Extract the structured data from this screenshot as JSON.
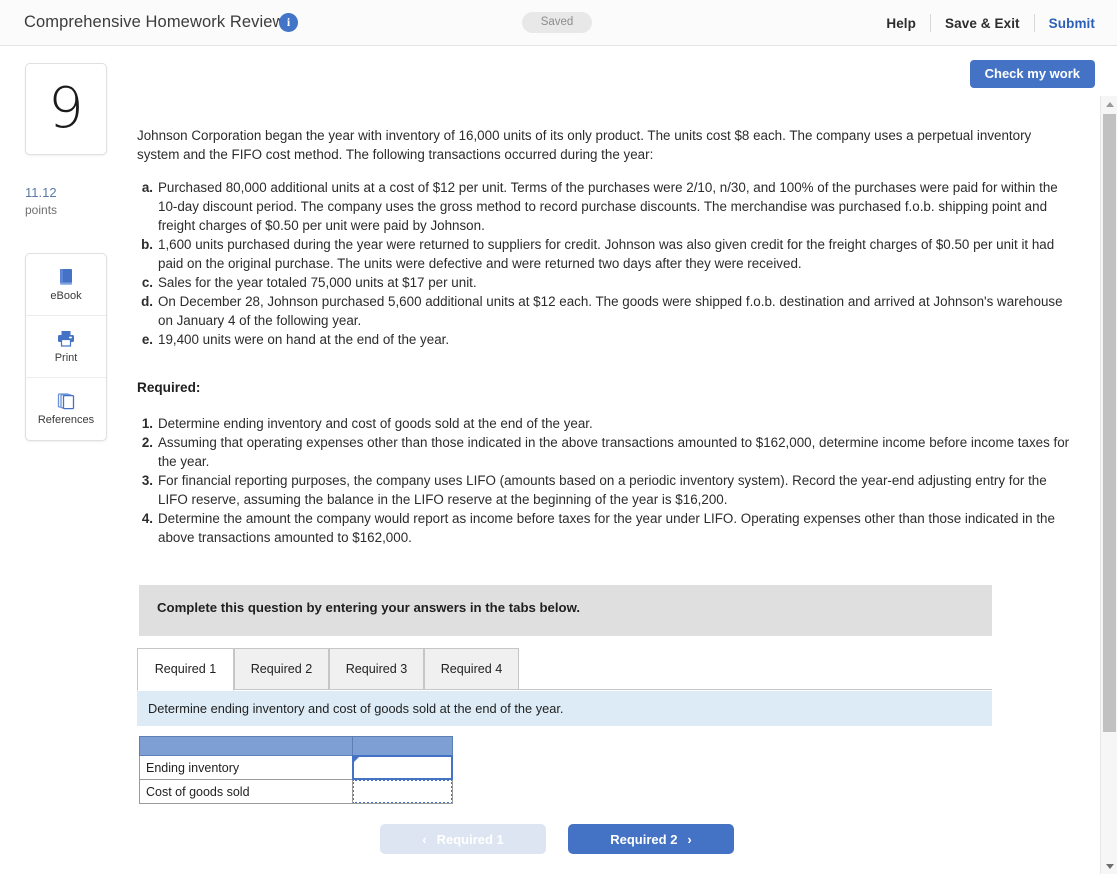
{
  "header": {
    "title": "Comprehensive Homework Review",
    "info_icon": "info-icon",
    "saved_label": "Saved",
    "help_label": "Help",
    "save_exit_label": "Save & Exit",
    "submit_label": "Submit",
    "accent_color": "#4472c4",
    "link_color": "#2c5fb8"
  },
  "sidebar": {
    "question_number": "9",
    "points_value": "11.12",
    "points_label": "points",
    "tools": [
      {
        "label": "eBook",
        "icon": "book-icon"
      },
      {
        "label": "Print",
        "icon": "printer-icon"
      },
      {
        "label": "References",
        "icon": "copy-pages-icon"
      }
    ]
  },
  "toolbar": {
    "check_my_work_label": "Check my work"
  },
  "question": {
    "intro": "Johnson Corporation began the year with inventory of 16,000 units of its only product. The units cost $8 each. The company uses a perpetual inventory system and the FIFO cost method. The following transactions occurred during the year:",
    "transactions": [
      {
        "marker": "a.",
        "text": "Purchased 80,000 additional units at a cost of $12 per unit. Terms of the purchases were 2/10, n/30, and 100% of the purchases were paid for within the 10-day discount period. The company uses the gross method to record purchase discounts. The merchandise was purchased f.o.b. shipping point and freight charges of $0.50 per unit were paid by Johnson."
      },
      {
        "marker": "b.",
        "text": "1,600 units purchased during the year were returned to suppliers for credit. Johnson was also given credit for the freight charges of $0.50 per unit it had paid on the original purchase. The units were defective and were returned two days after they were received."
      },
      {
        "marker": "c.",
        "text": "Sales for the year totaled 75,000 units at $17 per unit."
      },
      {
        "marker": "d.",
        "text": "On December 28, Johnson purchased 5,600 additional units at $12 each. The goods were shipped f.o.b. destination and arrived at Johnson's warehouse on January 4 of the following year."
      },
      {
        "marker": "e.",
        "text": "19,400 units were on hand at the end of the year."
      }
    ],
    "required_heading": "Required:",
    "requirements": [
      {
        "marker": "1.",
        "text": "Determine ending inventory and cost of goods sold at the end of the year."
      },
      {
        "marker": "2.",
        "text": "Assuming that operating expenses other than those indicated in the above transactions amounted to $162,000, determine income before income taxes for the year."
      },
      {
        "marker": "3.",
        "text": "For financial reporting purposes, the company uses LIFO (amounts based on a periodic inventory system). Record the year-end adjusting entry for the LIFO reserve, assuming the balance in the LIFO reserve at the beginning of the year is $16,200."
      },
      {
        "marker": "4.",
        "text": "Determine the amount the company would report as income before taxes for the year under LIFO. Operating expenses other than those indicated in the above transactions amounted to $162,000."
      }
    ]
  },
  "answer_area": {
    "banner_text": "Complete this question by entering your answers in the tabs below.",
    "tabs": [
      {
        "label": "Required 1",
        "active": true
      },
      {
        "label": "Required 2",
        "active": false
      },
      {
        "label": "Required 3",
        "active": false
      },
      {
        "label": "Required 4",
        "active": false
      }
    ],
    "instruction": "Determine ending inventory and cost of goods sold at the end of the year.",
    "table": {
      "header_row": [
        "",
        ""
      ],
      "rows": [
        {
          "label": "Ending inventory",
          "value": "",
          "state": "selected"
        },
        {
          "label": "Cost of goods sold",
          "value": "",
          "state": "dotted"
        }
      ]
    },
    "nav": {
      "prev_label": "Required 1",
      "prev_chevron": "chevron-left-icon",
      "next_label": "Required 2",
      "next_chevron": "chevron-right-icon"
    }
  },
  "scrollbar": {
    "up_arrow": "scroll-up-arrow-icon",
    "down_arrow": "scroll-down-arrow-icon"
  }
}
